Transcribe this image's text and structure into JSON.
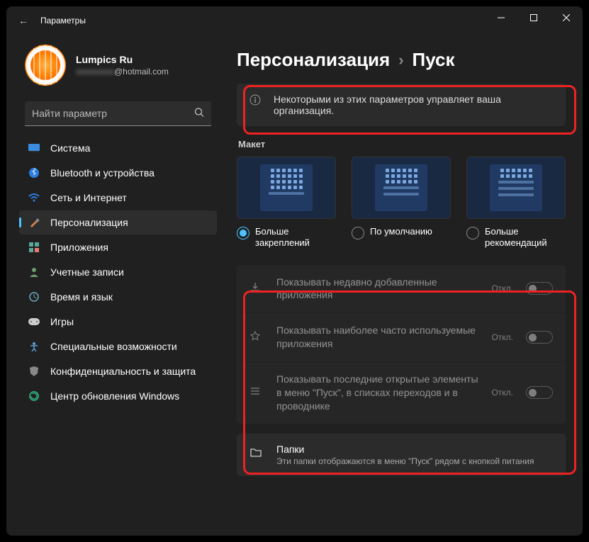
{
  "window": {
    "title": "Параметры"
  },
  "profile": {
    "name": "Lumpics Ru",
    "email_suffix": "@hotmail.com"
  },
  "search": {
    "placeholder": "Найти параметр"
  },
  "sidebar": {
    "items": [
      {
        "label": "Система"
      },
      {
        "label": "Bluetooth и устройства"
      },
      {
        "label": "Сеть и Интернет"
      },
      {
        "label": "Персонализация"
      },
      {
        "label": "Приложения"
      },
      {
        "label": "Учетные записи"
      },
      {
        "label": "Время и язык"
      },
      {
        "label": "Игры"
      },
      {
        "label": "Специальные возможности"
      },
      {
        "label": "Конфиденциальность и защита"
      },
      {
        "label": "Центр обновления Windows"
      }
    ]
  },
  "breadcrumb": {
    "first": "Персонализация",
    "second": "Пуск"
  },
  "banner": {
    "text": "Некоторыми из этих параметров управляет ваша организация."
  },
  "layout": {
    "title": "Макет",
    "opts": [
      {
        "label": "Больше закреплений"
      },
      {
        "label": "По умолчанию"
      },
      {
        "label": "Больше рекомендаций"
      }
    ]
  },
  "settings": [
    {
      "label": "Показывать недавно добавленные приложения",
      "state": "Откл."
    },
    {
      "label": "Показывать наиболее часто используемые приложения",
      "state": "Откл."
    },
    {
      "label": "Показывать последние открытые элементы в меню \"Пуск\", в списках переходов и в проводнике",
      "state": "Откл."
    }
  ],
  "folders": {
    "title": "Папки",
    "desc": "Эти папки отображаются в меню \"Пуск\" рядом с кнопкой питания"
  }
}
